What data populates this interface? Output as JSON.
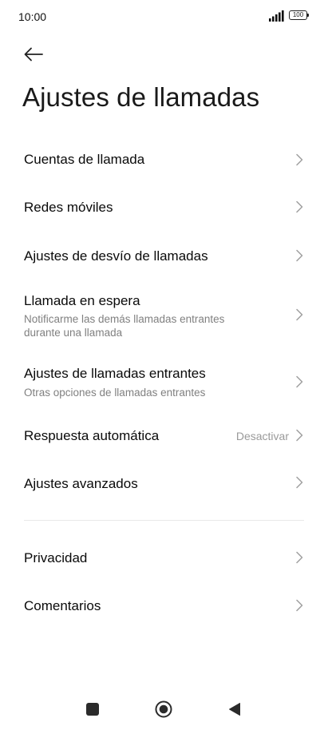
{
  "status_bar": {
    "time": "10:00",
    "battery": "100",
    "signal_icon": "signal-bars-icon"
  },
  "header": {
    "back_icon": "arrow-left-icon",
    "title": "Ajustes de llamadas"
  },
  "items": [
    {
      "title": "Cuentas de llamada"
    },
    {
      "title": "Redes móviles"
    },
    {
      "title": "Ajustes de desvío de llamadas"
    },
    {
      "title": "Llamada en espera",
      "subtitle": "Notificarme las demás llamadas entrantes durante una llamada"
    },
    {
      "title": "Ajustes de llamadas entrantes",
      "subtitle": "Otras opciones de llamadas entrantes"
    },
    {
      "title": "Respuesta automática",
      "value": "Desactivar"
    },
    {
      "title": "Ajustes avanzados"
    },
    {
      "title": "Privacidad"
    },
    {
      "title": "Comentarios"
    }
  ],
  "nav_bar": {
    "recents_icon": "square-icon",
    "home_icon": "circle-home-icon",
    "back_icon": "triangle-back-icon"
  },
  "colors": {
    "background": "#ffffff",
    "title_text": "#1a1a1a",
    "subtitle_text": "#808080",
    "chevron": "#a0a0a0",
    "divider": "#e8e8e8"
  }
}
